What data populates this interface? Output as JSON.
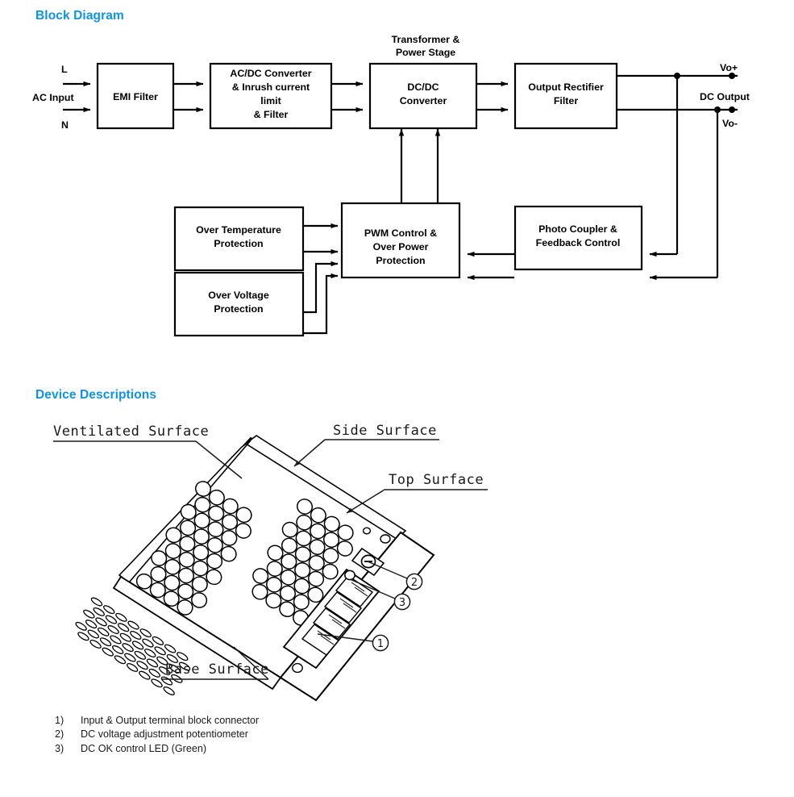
{
  "sections": {
    "block_diagram": {
      "heading": "Block Diagram"
    },
    "device_descriptions": {
      "heading": "Device Descriptions"
    }
  },
  "block_diagram": {
    "input_labels": {
      "line": "L",
      "neutral": "N",
      "source": "AC Input"
    },
    "output_labels": {
      "positive": "Vo+",
      "negative": "Vo-",
      "group": "DC Output"
    },
    "annotations": [
      {
        "id": "transformer-note",
        "line1": "Transformer &",
        "line2": "Power Stage"
      }
    ],
    "blocks": [
      {
        "id": "emi-filter",
        "lines": [
          "EMI Filter"
        ]
      },
      {
        "id": "acdc-converter",
        "lines": [
          "AC/DC Converter",
          "& Inrush current",
          "limit",
          "& Filter"
        ]
      },
      {
        "id": "dcdc-converter",
        "lines": [
          "DC/DC",
          "Converter"
        ]
      },
      {
        "id": "output-rectifier",
        "lines": [
          "Output Rectifier",
          "Filter"
        ]
      },
      {
        "id": "over-temperature-protection",
        "lines": [
          "Over Temperature",
          "Protection"
        ]
      },
      {
        "id": "over-voltage-protection",
        "lines": [
          "Over Voltage",
          "Protection"
        ]
      },
      {
        "id": "pwm-control",
        "lines": [
          "PWM Control &",
          "Over Power",
          "Protection"
        ]
      },
      {
        "id": "photo-coupler",
        "lines": [
          "Photo Coupler &",
          "Feedback Control"
        ]
      }
    ]
  },
  "device_illustration": {
    "surface_labels": [
      {
        "id": "ventilated-surface",
        "text": "Ventilated  Surface"
      },
      {
        "id": "side-surface",
        "text": "Side  Surface"
      },
      {
        "id": "top-surface",
        "text": "Top  Surface"
      },
      {
        "id": "base-surface",
        "text": "Base  Surface"
      }
    ],
    "callouts": [
      {
        "id": "callout-1",
        "text": "1"
      },
      {
        "id": "callout-2",
        "text": "2"
      },
      {
        "id": "callout-3",
        "text": "3"
      }
    ]
  },
  "legend": {
    "items": [
      {
        "num": "1)",
        "text": "Input & Output terminal block connector"
      },
      {
        "num": "2)",
        "text": "DC voltage adjustment potentiometer"
      },
      {
        "num": "3)",
        "text": "DC OK control LED (Green)"
      }
    ]
  },
  "colors": {
    "heading_blue": "#0d93e8",
    "line_black": "#000000",
    "body_text": "#1a1a1a"
  }
}
